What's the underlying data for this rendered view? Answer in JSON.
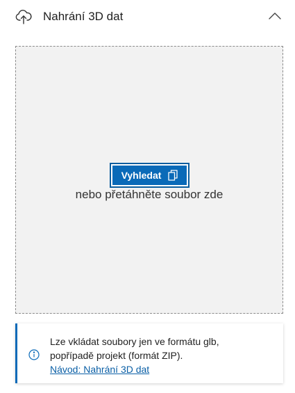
{
  "header": {
    "title": "Nahrání 3D dat",
    "upload_icon": "cloud-upload-icon",
    "toggle_icon": "chevron-up-icon"
  },
  "dropzone": {
    "browse_label": "Vyhledat",
    "browse_icon": "copy-icon",
    "hint": "nebo přetáhněte soubor zde"
  },
  "info": {
    "icon": "info-icon",
    "line1": "Lze vkládat soubory jen ve formátu glb,",
    "line2": "popřípadě projekt (formát ZIP).",
    "link": "Návod: Nahrání 3D dat"
  },
  "colors": {
    "accent": "#0a6ab8",
    "dropzone_bg": "#f2f2f2",
    "link": "#0a5fa6"
  }
}
